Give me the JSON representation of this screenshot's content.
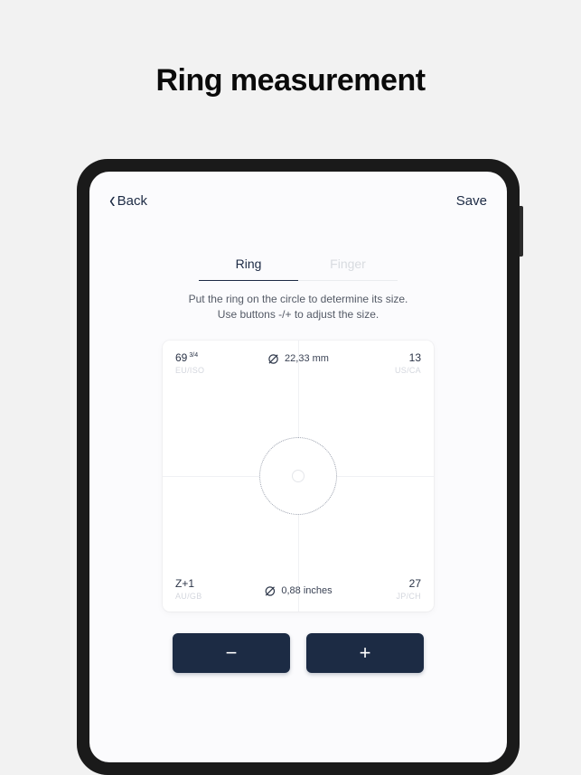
{
  "page": {
    "title": "Ring measurement"
  },
  "nav": {
    "back": "Back",
    "save": "Save"
  },
  "tabs": {
    "ring": "Ring",
    "finger": "Finger"
  },
  "instruction": {
    "line1": "Put the ring on the circle to determine its size.",
    "line2": "Use buttons -/+ to adjust the size."
  },
  "sizes": {
    "eu_iso": {
      "value": "69",
      "fraction": "3/4",
      "label": "EU/ISO"
    },
    "us_ca": {
      "value": "13",
      "label": "US/CA"
    },
    "au_gb": {
      "value": "Z+1",
      "label": "AU/GB"
    },
    "jp_ch": {
      "value": "27",
      "label": "JP/CH"
    },
    "diameter_mm": "22,33 mm",
    "diameter_in": "0,88 inches"
  },
  "controls": {
    "minus": "−",
    "plus": "+"
  }
}
